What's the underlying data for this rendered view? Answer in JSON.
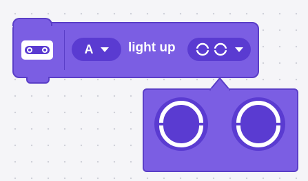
{
  "block": {
    "category_icon": "ultrasonic-sensor-icon",
    "port": {
      "value": "A",
      "icon": "chevron-down-icon"
    },
    "action_label": "light up",
    "pattern_selector": {
      "icon": "eyes-icon",
      "dropdown_icon": "chevron-down-icon"
    }
  },
  "popup": {
    "options": [
      {
        "name": "left-eye",
        "icon": "eye-segment-icon"
      },
      {
        "name": "right-eye",
        "icon": "eye-segment-icon"
      }
    ]
  },
  "colors": {
    "block": "#7b5ee3",
    "block_border": "#5a3ec7",
    "field": "#5a3bd1",
    "text": "#ffffff",
    "canvas": "#f5f5f8"
  }
}
